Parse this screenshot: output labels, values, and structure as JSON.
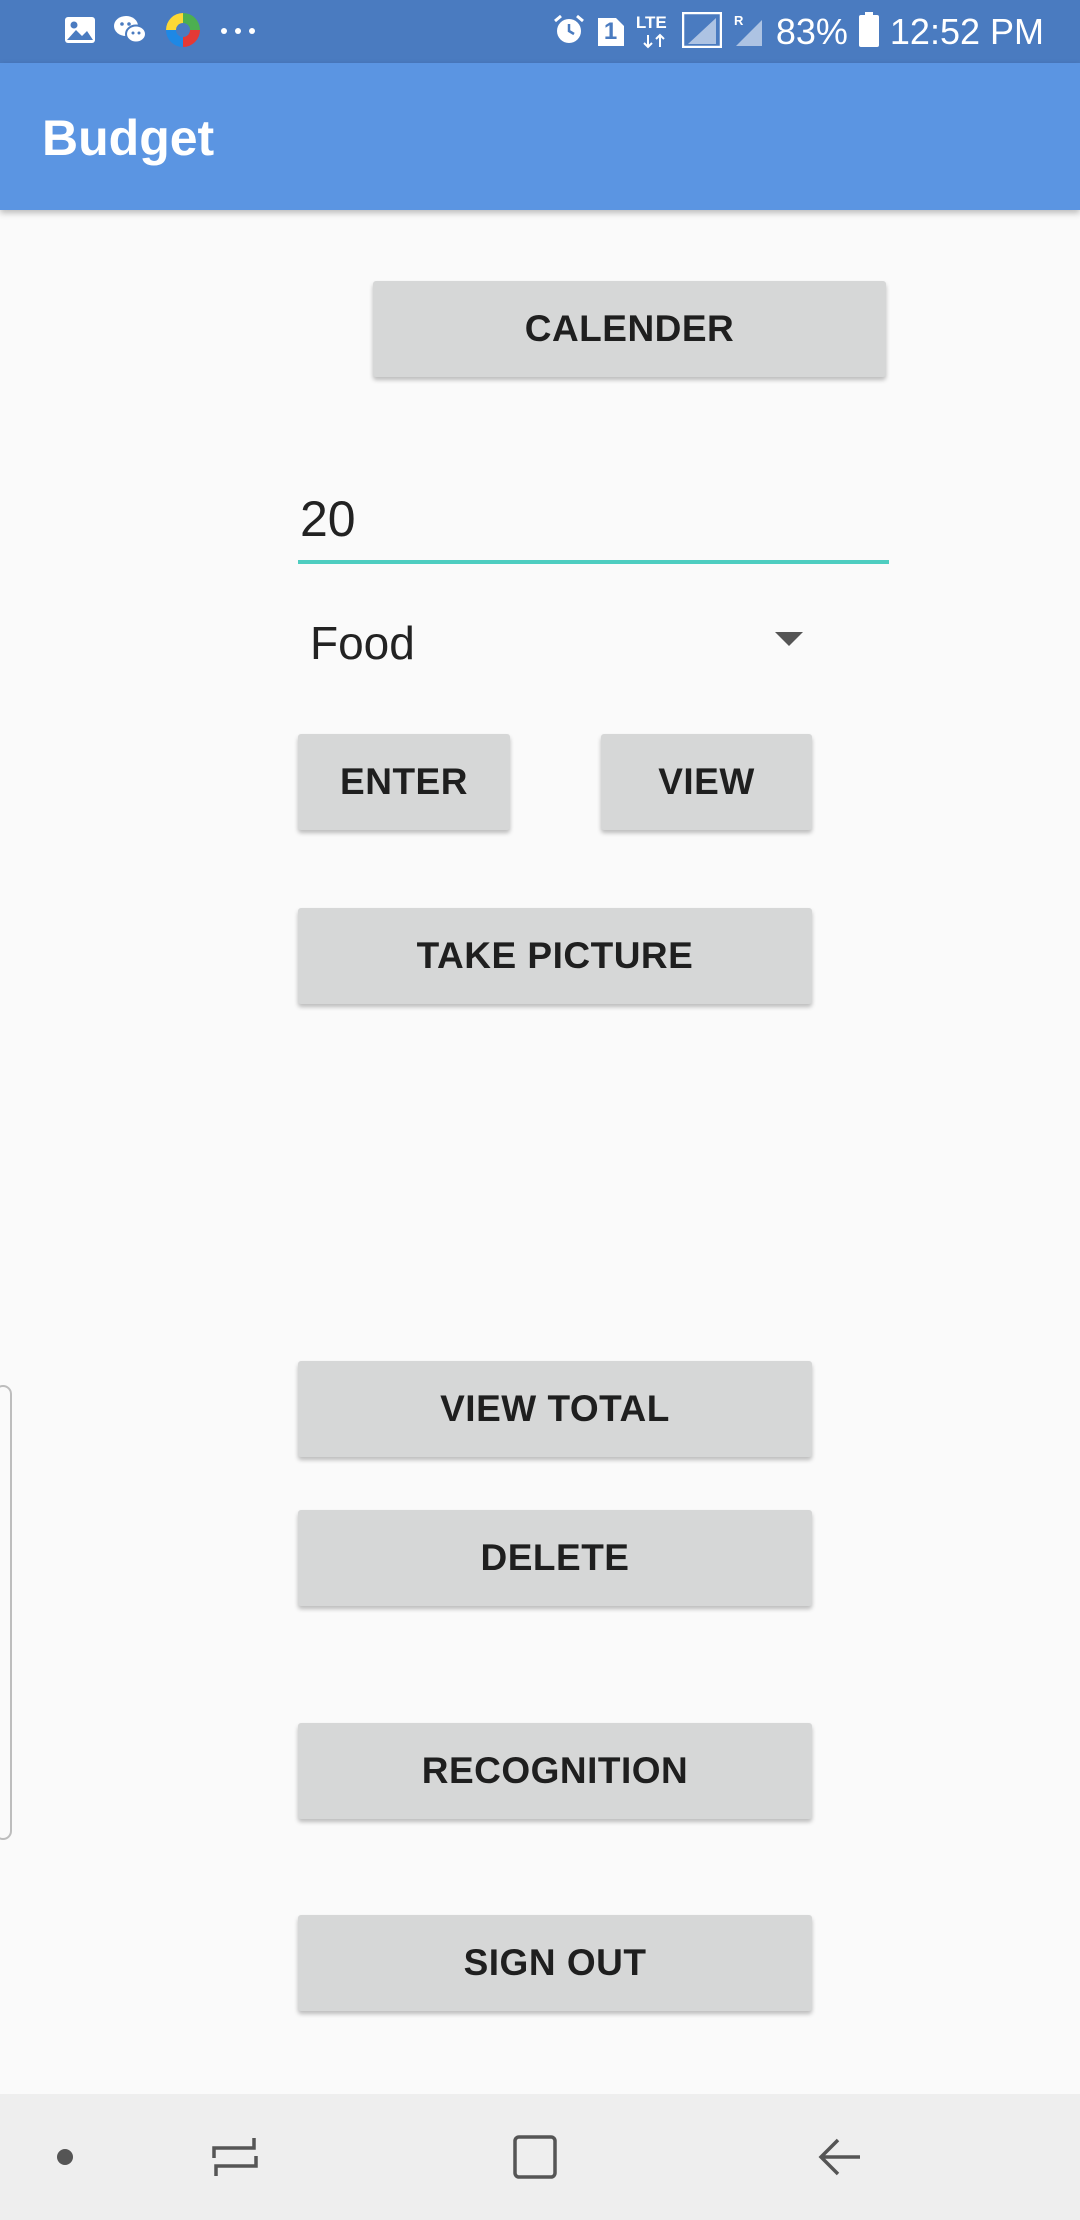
{
  "status_bar": {
    "battery_percent": "83%",
    "time": "12:52 PM",
    "network_label": "LTE",
    "sim_badge": "1",
    "left_icons": [
      "gallery-icon",
      "wechat-icon",
      "colorful-app-icon",
      "more-dots-icon"
    ],
    "right_icons": [
      "alarm-icon",
      "sim-icon",
      "lte-icon",
      "signal-icon",
      "roaming-signal-icon",
      "battery-icon"
    ]
  },
  "app_bar": {
    "title": "Budget"
  },
  "form": {
    "calendar_label": "CALENDER",
    "amount_value": "20",
    "category_selected": "Food",
    "enter_label": "ENTER",
    "view_label": "VIEW",
    "take_picture_label": "TAKE PICTURE",
    "view_total_label": "VIEW TOTAL",
    "delete_label": "DELETE",
    "recognition_label": "RECOGNITION",
    "sign_out_label": "SIGN OUT"
  },
  "nav_bar": {
    "items": [
      "dot-indicator-icon",
      "recents-icon",
      "home-icon",
      "back-icon"
    ]
  },
  "colors": {
    "status_bar": "#4a7bc0",
    "app_bar": "#5b95e2",
    "accent_underline": "#4ecdc0",
    "button_bg": "#d6d7d7",
    "background": "#fafafa"
  }
}
